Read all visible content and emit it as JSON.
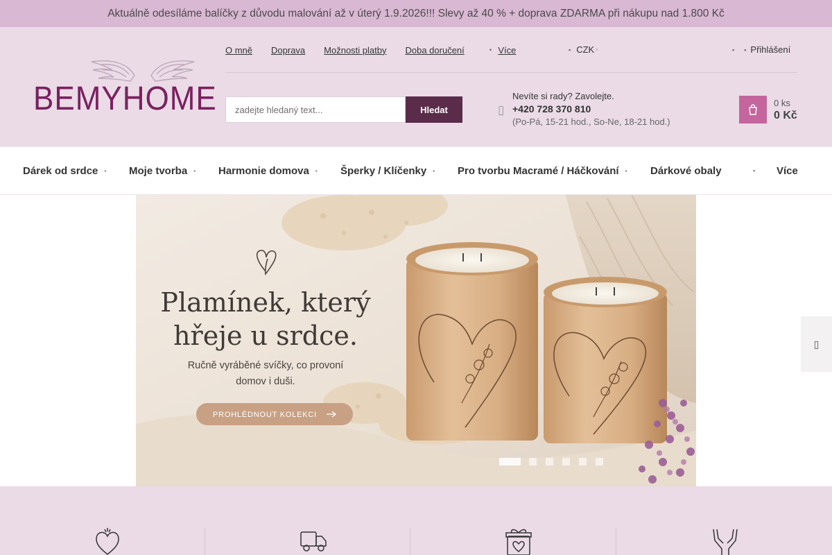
{
  "announcement": "Aktuálně odesíláme balíčky z důvodu malování až v úterý 1.9.2026!!! Slevy až 40 % + doprava ZDARMA při nákupu nad 1.800 Kč",
  "logo": {
    "text": "BEMYHOME"
  },
  "top_links": [
    "O mně",
    "Doprava",
    "Možnosti platby",
    "Doba doručení"
  ],
  "more_label": "Více",
  "currency": "CZK",
  "login_label": "Přihlášení",
  "search": {
    "placeholder": "zadejte hledaný text...",
    "button": "Hledat"
  },
  "contact": {
    "title": "Nevíte si rady? Zavolejte.",
    "phone": "+420 728 370 810",
    "hours": "(Po-Pá, 15-21 hod., So-Ne, 18-21 hod.)"
  },
  "cart": {
    "count": "0 ks",
    "price": "0 Kč"
  },
  "nav": {
    "items": [
      "Dárek od srdce",
      "Moje tvorba",
      "Harmonie domova",
      "Šperky / Klíčenky",
      "Pro tvorbu Macramé / Háčkování",
      "Dárkové obaly"
    ],
    "more": "Více"
  },
  "hero": {
    "headline_line1": "Plamínek, který",
    "headline_line2": "hřeje u srdce.",
    "sub_line1": "Ručně vyráběné svíčky, co provoní",
    "sub_line2": "domov i duši.",
    "cta": "PROHLÉDNOUT KOLEKCI",
    "slides": 6,
    "active_slide": 1
  },
  "colors": {
    "announcement_bg": "#d9b8d3",
    "header_bg": "#eadbe7",
    "brand": "#7a2160",
    "search_button": "#5b2b4a",
    "cart_button": "#c4659d"
  },
  "icons": {
    "feature_1": "heart-hand-icon",
    "feature_2": "truck-icon",
    "feature_3": "gift-box-icon",
    "feature_4": "hands-icon"
  }
}
